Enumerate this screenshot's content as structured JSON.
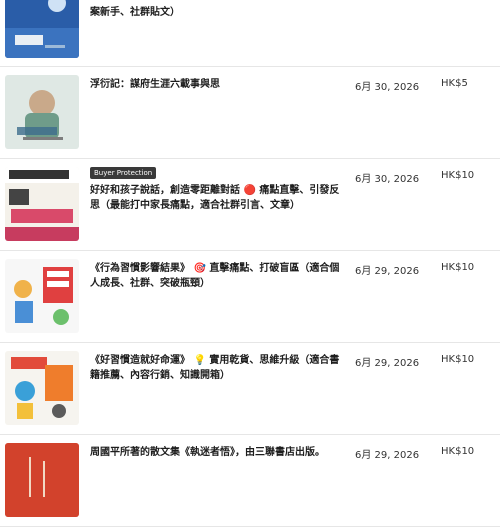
{
  "listings": [
    {
      "title": "案新手、社群貼文）",
      "date": "",
      "price": "",
      "badge": "",
      "cover": "book-cover-blue-sky"
    },
    {
      "title": "浮衍記：謀府生涯六載事與思",
      "date": "6月 30, 2026",
      "price": "HK$5",
      "badge": "",
      "cover": "book-cover-fuyanji"
    },
    {
      "title": "好好和孩子說話，創造零距離對話 🔴 痛點直擊、引發反思（最能打中家長痛點，適合社群引言、文章）",
      "date": "6月 30, 2026",
      "price": "HK$10",
      "badge": "Buyer Protection",
      "cover": "book-cover-talk-to-kids"
    },
    {
      "title": "《行為習慣影響結果》 🎯 直擊痛點、打破盲區（適合個人成長、社群、突破瓶頸）",
      "date": "6月 29, 2026",
      "price": "HK$10",
      "badge": "",
      "cover": "book-cover-habits-results"
    },
    {
      "title": "《好習慣造就好命運》 💡 實用乾貨、思維升級（適合書籍推薦、內容行銷、知識開箱）",
      "date": "6月 29, 2026",
      "price": "HK$10",
      "badge": "",
      "cover": "book-cover-good-habits"
    },
    {
      "title": "周國平所著的散文集《執迷者悟》，由三聯書店出版。",
      "date": "6月 29, 2026",
      "price": "HK$10",
      "badge": "",
      "cover": "book-cover-zhimizhewu"
    }
  ],
  "colors": {
    "divider": "#e6e6e6",
    "badge_bg": "#3a3a3a"
  }
}
